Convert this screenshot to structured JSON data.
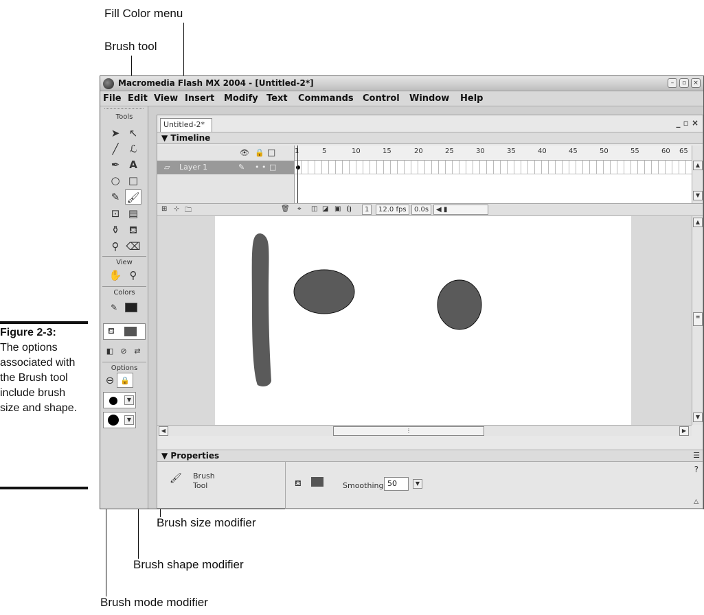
{
  "callouts": {
    "fill_color_menu": "Fill Color menu",
    "brush_tool": "Brush tool",
    "brush_size_modifier": "Brush size modifier",
    "brush_shape_modifier": "Brush shape modifier",
    "brush_mode_modifier": "Brush mode modifier"
  },
  "caption": {
    "label": "Figure 2-3:",
    "text": "The options associated with the Brush tool include brush size and shape."
  },
  "window": {
    "title": "Macromedia Flash MX 2004 - [Untitled-2*]",
    "controls": [
      "–",
      "▫",
      "×"
    ]
  },
  "menu": [
    "File",
    "Edit",
    "View",
    "Insert",
    "Modify",
    "Text",
    "Commands",
    "Control",
    "Window",
    "Help"
  ],
  "tools_panel": {
    "title": "Tools",
    "view_label": "View",
    "colors_label": "Colors",
    "options_label": "Options",
    "stroke_color": "#222222",
    "fill_color": "#555555"
  },
  "document": {
    "tab_label": "Untitled-2*",
    "controls": "_ ▫ ×"
  },
  "timeline": {
    "header": "▼ Timeline",
    "layer_name": "Layer 1",
    "frame_numbers": [
      "1",
      "5",
      "10",
      "15",
      "20",
      "25",
      "30",
      "35",
      "40",
      "45",
      "50",
      "55",
      "60",
      "65"
    ],
    "current_frame": "1",
    "fps": "12.0 fps",
    "elapsed": "0.0s"
  },
  "properties": {
    "header": "▼ Properties",
    "tool_line1": "Brush",
    "tool_line2": "Tool",
    "smoothing_label": "Smoothing",
    "smoothing_value": "50"
  },
  "stage": {
    "shape_color": "#5a5a5a"
  }
}
